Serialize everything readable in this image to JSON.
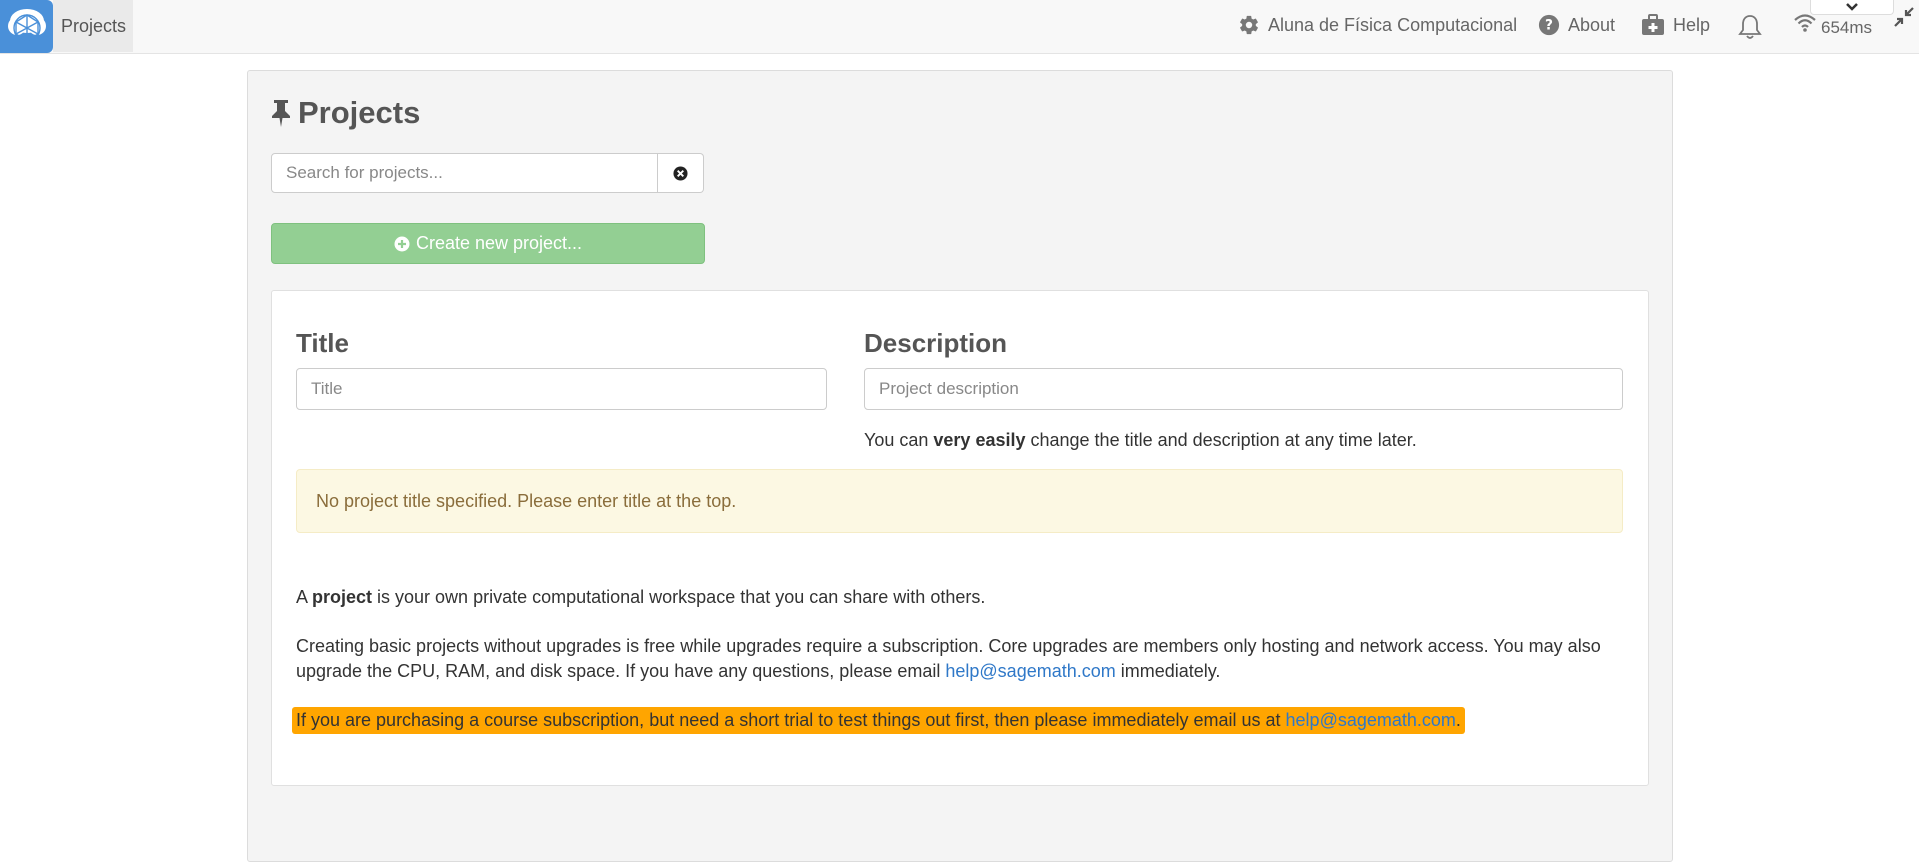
{
  "topbar": {
    "projects_label": "Projects",
    "account_label": "Aluna de Física Computacional",
    "about_label": "About",
    "help_label": "Help",
    "ping_label": "654ms"
  },
  "page": {
    "title": "Projects",
    "search_placeholder": "Search for projects...",
    "create_button_label": "Create new project..."
  },
  "new_project": {
    "title_label": "Title",
    "title_placeholder": "Title",
    "description_label": "Description",
    "description_placeholder": "Project description",
    "hint_prefix": "You can ",
    "hint_bold": "very easily",
    "hint_suffix": " change the title and description at any time later.",
    "warning_text": "No project title specified. Please enter title at the top."
  },
  "info": {
    "p1_prefix": "A ",
    "p1_bold": "project",
    "p1_suffix": " is your own private computational workspace that you can share with others.",
    "p2_text": "Creating basic projects without upgrades is free while upgrades require a subscription. Core upgrades are members only hosting and network access. You may also upgrade the CPU, RAM, and disk space. If you have any questions, please email ",
    "p2_email": "help@sagemath.com",
    "p2_suffix": " immediately.",
    "trial_text": "If you are purchasing a course subscription, but need a short trial to test things out first, then please immediately email us at ",
    "trial_email": "help@sagemath.com",
    "trial_suffix": "."
  },
  "colors": {
    "logo_bg": "#4a90d9",
    "create_button": "#93cf93",
    "warning_bg": "#fcf8e3",
    "trial_highlight": "#ffa500",
    "link": "#2f78c8"
  }
}
